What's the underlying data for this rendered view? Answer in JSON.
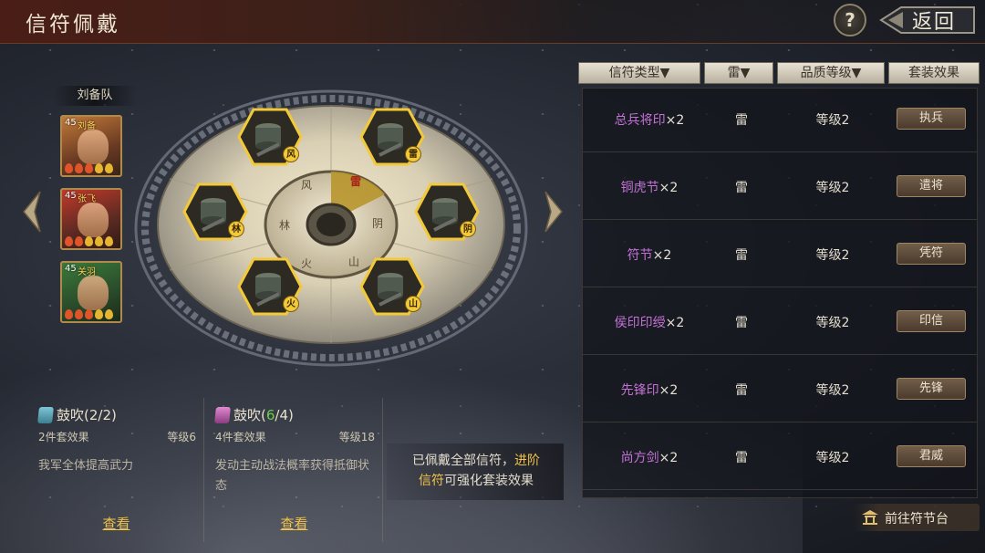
{
  "header": {
    "title": "信符佩戴",
    "help_label": "?",
    "back_label": "返回"
  },
  "team": {
    "label": "刘备队",
    "heroes": [
      {
        "level": "45",
        "name": "刘备",
        "pips": [
          "red",
          "red",
          "red",
          "gold",
          "gold"
        ]
      },
      {
        "level": "45",
        "name": "张飞",
        "pips": [
          "red",
          "red",
          "gold",
          "gold",
          "gold"
        ]
      },
      {
        "level": "45",
        "name": "关羽",
        "pips": [
          "red",
          "red",
          "red",
          "gold",
          "gold"
        ]
      }
    ]
  },
  "wheel": {
    "slots": [
      {
        "name": "风",
        "filled": true
      },
      {
        "name": "雷",
        "filled": true
      },
      {
        "name": "林",
        "filled": true
      },
      {
        "name": "阴",
        "filled": true
      },
      {
        "name": "火",
        "filled": true
      },
      {
        "name": "山",
        "filled": true
      }
    ],
    "hub_labels": [
      "风",
      "雷",
      "阴",
      "山",
      "火",
      "林"
    ],
    "active": "雷"
  },
  "filters": {
    "type": "信符类型▼",
    "attr": "雷▼",
    "grade": "品质等级▼",
    "set": "套装效果"
  },
  "sets": [
    {
      "name": "总兵将印",
      "mult": "×2",
      "attr": "雷",
      "grade": "等级2",
      "effect": "执兵"
    },
    {
      "name": "铜虎节",
      "mult": "×2",
      "attr": "雷",
      "grade": "等级2",
      "effect": "遣将"
    },
    {
      "name": "符节",
      "mult": "×2",
      "attr": "雷",
      "grade": "等级2",
      "effect": "凭符"
    },
    {
      "name": "侯印印绶",
      "mult": "×2",
      "attr": "雷",
      "grade": "等级2",
      "effect": "印信"
    },
    {
      "name": "先锋印",
      "mult": "×2",
      "attr": "雷",
      "grade": "等级2",
      "effect": "先锋"
    },
    {
      "name": "尚方剑",
      "mult": "×2",
      "attr": "雷",
      "grade": "等级2",
      "effect": "君威"
    }
  ],
  "go_button": "前往符节台",
  "panels": [
    {
      "title": "鼓吹",
      "progress_have": "2",
      "progress_need": "2",
      "count": "2件套效果",
      "level": "等级6",
      "desc": "我军全体提高武力",
      "view": "查看"
    },
    {
      "title": "鼓吹",
      "progress_have": "6",
      "progress_need": "4",
      "count": "4件套效果",
      "level": "等级18",
      "desc": "发动主动战法概率获得抵御状态",
      "view": "查看"
    }
  ],
  "info": {
    "text_a": "已佩戴全部信符，",
    "text_hl_1": "进阶",
    "text_hl_2": "信符",
    "text_b": "可强化套装效果"
  },
  "colors": {
    "accent_gold": "#f0c24a",
    "set_name": "#c372d6",
    "progress_over": "#6ad04a"
  }
}
